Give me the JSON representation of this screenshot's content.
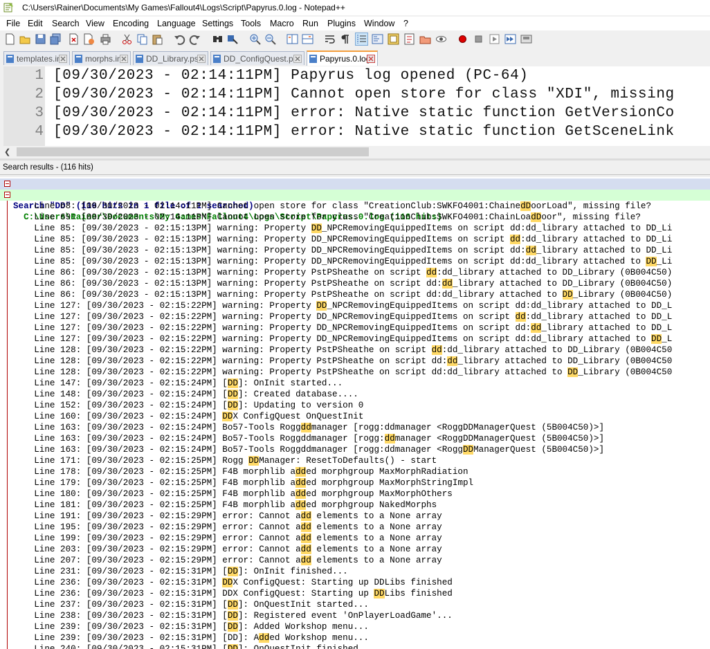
{
  "window": {
    "title": "C:\\Users\\Rainer\\Documents\\My Games\\Fallout4\\Logs\\Script\\Papyrus.0.log - Notepad++"
  },
  "menu": [
    "File",
    "Edit",
    "Search",
    "View",
    "Encoding",
    "Language",
    "Settings",
    "Tools",
    "Macro",
    "Run",
    "Plugins",
    "Window",
    "?"
  ],
  "toolbar_icons": [
    "new-icon",
    "open-icon",
    "save-icon",
    "save-all-icon",
    "close-icon",
    "close-all-icon",
    "print-icon",
    "cut-icon",
    "copy-icon",
    "paste-icon",
    "undo-icon",
    "redo-icon",
    "find-icon",
    "replace-icon",
    "zoom-in-icon",
    "zoom-out-icon",
    "sync-vertical-icon",
    "sync-horizontal-icon",
    "word-wrap-icon",
    "show-all-chars-icon",
    "indent-guide-icon",
    "udl-icon",
    "doc-map-icon",
    "function-list-icon",
    "folder-workspace-icon",
    "monitor-icon",
    "record-macro-icon",
    "stop-macro-icon",
    "play-macro-icon",
    "run-macro-multiple-icon",
    "save-macro-icon"
  ],
  "tabs": [
    {
      "label": "templates.ini",
      "active": false
    },
    {
      "label": "morphs.ini",
      "active": false
    },
    {
      "label": "DD_Library.psc",
      "active": false
    },
    {
      "label": "DD_ConfigQuest.psc",
      "active": false
    },
    {
      "label": "Papyrus.0.log",
      "active": true
    }
  ],
  "editor": {
    "lines": [
      {
        "n": "1",
        "text": "[09/30/2023 - 02:14:11PM] Papyrus log opened (PC-64)"
      },
      {
        "n": "2",
        "text": "[09/30/2023 - 02:14:11PM] Cannot open store for class \"XDI\", missing"
      },
      {
        "n": "3",
        "text": "[09/30/2023 - 02:14:11PM] error: Native static function GetVersionCo"
      },
      {
        "n": "4",
        "text": "[09/30/2023 - 02:14:11PM] error: Native static function GetSceneLink"
      }
    ]
  },
  "search_panel": {
    "header": "Search results - (116 hits)",
    "search_line": "Search \"DD\" (116 hits in 1 file of 1 searched)",
    "file_line": "  C:\\Users\\Rainer\\Documents\\My Games\\Fallout4\\Logs\\Script\\Papyrus.0.log (116 hits)",
    "hits": [
      {
        "pre": "    Line 68: [09/30/2023 - 02:14:11PM] Cannot open store for class \"CreationClub:SWKFO4001:Chaine",
        "hl": "dD",
        "post": "oorLoad\", missing file?"
      },
      {
        "pre": "    Line 69: [09/30/2023 - 02:14:11PM] Cannot open store for class \"CreationClub:SWKFO4001:ChainLoa",
        "hl": "dD",
        "post": "oor\", missing file?"
      },
      {
        "pre": "    Line 85: [09/30/2023 - 02:15:13PM] warning: Property ",
        "hl": "DD",
        "post": "_NPCRemovingEquippedItems on script dd:dd_library attached to DD_Li"
      },
      {
        "pre": "    Line 85: [09/30/2023 - 02:15:13PM] warning: Property DD_NPCRemovingEquippedItems on script ",
        "hl": "dd",
        "post": ":dd_library attached to DD_Li"
      },
      {
        "pre": "    Line 85: [09/30/2023 - 02:15:13PM] warning: Property DD_NPCRemovingEquippedItems on script dd:",
        "hl": "dd",
        "post": "_library attached to DD_Li"
      },
      {
        "pre": "    Line 85: [09/30/2023 - 02:15:13PM] warning: Property DD_NPCRemovingEquippedItems on script dd:dd_library attached to ",
        "hl": "DD",
        "post": "_Li"
      },
      {
        "pre": "    Line 86: [09/30/2023 - 02:15:13PM] warning: Property PstPSheathe on script ",
        "hl": "dd",
        "post": ":dd_library attached to DD_Library (0B004C50)"
      },
      {
        "pre": "    Line 86: [09/30/2023 - 02:15:13PM] warning: Property PstPSheathe on script dd:",
        "hl": "dd",
        "post": "_library attached to DD_Library (0B004C50)"
      },
      {
        "pre": "    Line 86: [09/30/2023 - 02:15:13PM] warning: Property PstPSheathe on script dd:dd_library attached to ",
        "hl": "DD",
        "post": "_Library (0B004C50)"
      },
      {
        "pre": "    Line 127: [09/30/2023 - 02:15:22PM] warning: Property ",
        "hl": "DD",
        "post": "_NPCRemovingEquippedItems on script dd:dd_library attached to DD_L"
      },
      {
        "pre": "    Line 127: [09/30/2023 - 02:15:22PM] warning: Property DD_NPCRemovingEquippedItems on script ",
        "hl": "dd",
        "post": ":dd_library attached to DD_L"
      },
      {
        "pre": "    Line 127: [09/30/2023 - 02:15:22PM] warning: Property DD_NPCRemovingEquippedItems on script dd:",
        "hl": "dd",
        "post": "_library attached to DD_L"
      },
      {
        "pre": "    Line 127: [09/30/2023 - 02:15:22PM] warning: Property DD_NPCRemovingEquippedItems on script dd:dd_library attached to ",
        "hl": "DD",
        "post": "_L"
      },
      {
        "pre": "    Line 128: [09/30/2023 - 02:15:22PM] warning: Property PstPSheathe on script ",
        "hl": "dd",
        "post": ":dd_library attached to DD_Library (0B004C50"
      },
      {
        "pre": "    Line 128: [09/30/2023 - 02:15:22PM] warning: Property PstPSheathe on script dd:",
        "hl": "dd",
        "post": "_library attached to DD_Library (0B004C50"
      },
      {
        "pre": "    Line 128: [09/30/2023 - 02:15:22PM] warning: Property PstPSheathe on script dd:dd_library attached to ",
        "hl": "DD",
        "post": "_Library (0B004C50"
      },
      {
        "pre": "    Line 147: [09/30/2023 - 02:15:24PM] [",
        "hl": "DD",
        "post": "]: OnInit started..."
      },
      {
        "pre": "    Line 148: [09/30/2023 - 02:15:24PM] [",
        "hl": "DD",
        "post": "]: Created database...."
      },
      {
        "pre": "    Line 152: [09/30/2023 - 02:15:24PM] [",
        "hl": "DD",
        "post": "]: Updating to version 0"
      },
      {
        "pre": "    Line 160: [09/30/2023 - 02:15:24PM] ",
        "hl": "DD",
        "post": "X ConfigQuest OnQuestInit"
      },
      {
        "pre": "    Line 163: [09/30/2023 - 02:15:24PM] Bo57-Tools Rogg",
        "hl": "dd",
        "post": "manager [rogg:ddmanager <RoggDDManagerQuest (5B004C50)>]"
      },
      {
        "pre": "    Line 163: [09/30/2023 - 02:15:24PM] Bo57-Tools Roggddmanager [rogg:",
        "hl": "dd",
        "post": "manager <RoggDDManagerQuest (5B004C50)>]"
      },
      {
        "pre": "    Line 163: [09/30/2023 - 02:15:24PM] Bo57-Tools Roggddmanager [rogg:ddmanager <Rogg",
        "hl": "DD",
        "post": "ManagerQuest (5B004C50)>]"
      },
      {
        "pre": "    Line 171: [09/30/2023 - 02:15:25PM] Rogg ",
        "hl": "DD",
        "post": "Manager: ResetToDefaults() - start"
      },
      {
        "pre": "    Line 178: [09/30/2023 - 02:15:25PM] F4B morphlib a",
        "hl": "dd",
        "post": "ed morphgroup MaxMorphRadiation"
      },
      {
        "pre": "    Line 179: [09/30/2023 - 02:15:25PM] F4B morphlib a",
        "hl": "dd",
        "post": "ed morphgroup MaxMorphStringImpl"
      },
      {
        "pre": "    Line 180: [09/30/2023 - 02:15:25PM] F4B morphlib a",
        "hl": "dd",
        "post": "ed morphgroup MaxMorphOthers"
      },
      {
        "pre": "    Line 181: [09/30/2023 - 02:15:25PM] F4B morphlib a",
        "hl": "dd",
        "post": "ed morphgroup NakedMorphs"
      },
      {
        "pre": "    Line 191: [09/30/2023 - 02:15:29PM] error: Cannot a",
        "hl": "dd",
        "post": " elements to a None array"
      },
      {
        "pre": "    Line 195: [09/30/2023 - 02:15:29PM] error: Cannot a",
        "hl": "dd",
        "post": " elements to a None array"
      },
      {
        "pre": "    Line 199: [09/30/2023 - 02:15:29PM] error: Cannot a",
        "hl": "dd",
        "post": " elements to a None array"
      },
      {
        "pre": "    Line 203: [09/30/2023 - 02:15:29PM] error: Cannot a",
        "hl": "dd",
        "post": " elements to a None array"
      },
      {
        "pre": "    Line 207: [09/30/2023 - 02:15:29PM] error: Cannot a",
        "hl": "dd",
        "post": " elements to a None array"
      },
      {
        "pre": "    Line 231: [09/30/2023 - 02:15:31PM] [",
        "hl": "DD",
        "post": "]: OnInit finished..."
      },
      {
        "pre": "    Line 236: [09/30/2023 - 02:15:31PM] ",
        "hl": "DD",
        "post": "X ConfigQuest: Starting up DDLibs finished"
      },
      {
        "pre": "    Line 236: [09/30/2023 - 02:15:31PM] DDX ConfigQuest: Starting up ",
        "hl": "DD",
        "post": "Libs finished"
      },
      {
        "pre": "    Line 237: [09/30/2023 - 02:15:31PM] [",
        "hl": "DD",
        "post": "]: OnQuestInit started..."
      },
      {
        "pre": "    Line 238: [09/30/2023 - 02:15:31PM] [",
        "hl": "DD",
        "post": "]: Registered event 'OnPlayerLoadGame'..."
      },
      {
        "pre": "    Line 239: [09/30/2023 - 02:15:31PM] [",
        "hl": "DD",
        "post": "]: Added Workshop menu..."
      },
      {
        "pre": "    Line 239: [09/30/2023 - 02:15:31PM] [DD]: A",
        "hl": "dd",
        "post": "ed Workshop menu..."
      },
      {
        "pre": "    Line 240: [09/30/2023 - 02:15:31PM] [",
        "hl": "DD",
        "post": "]: OnQuestInit finished..."
      }
    ]
  },
  "colors": {
    "highlight": "#ffd966",
    "search_row_bg": "#d5ddf0",
    "file_row_bg": "#d5ffd5",
    "active_tab_accent": "#f49e3c"
  }
}
